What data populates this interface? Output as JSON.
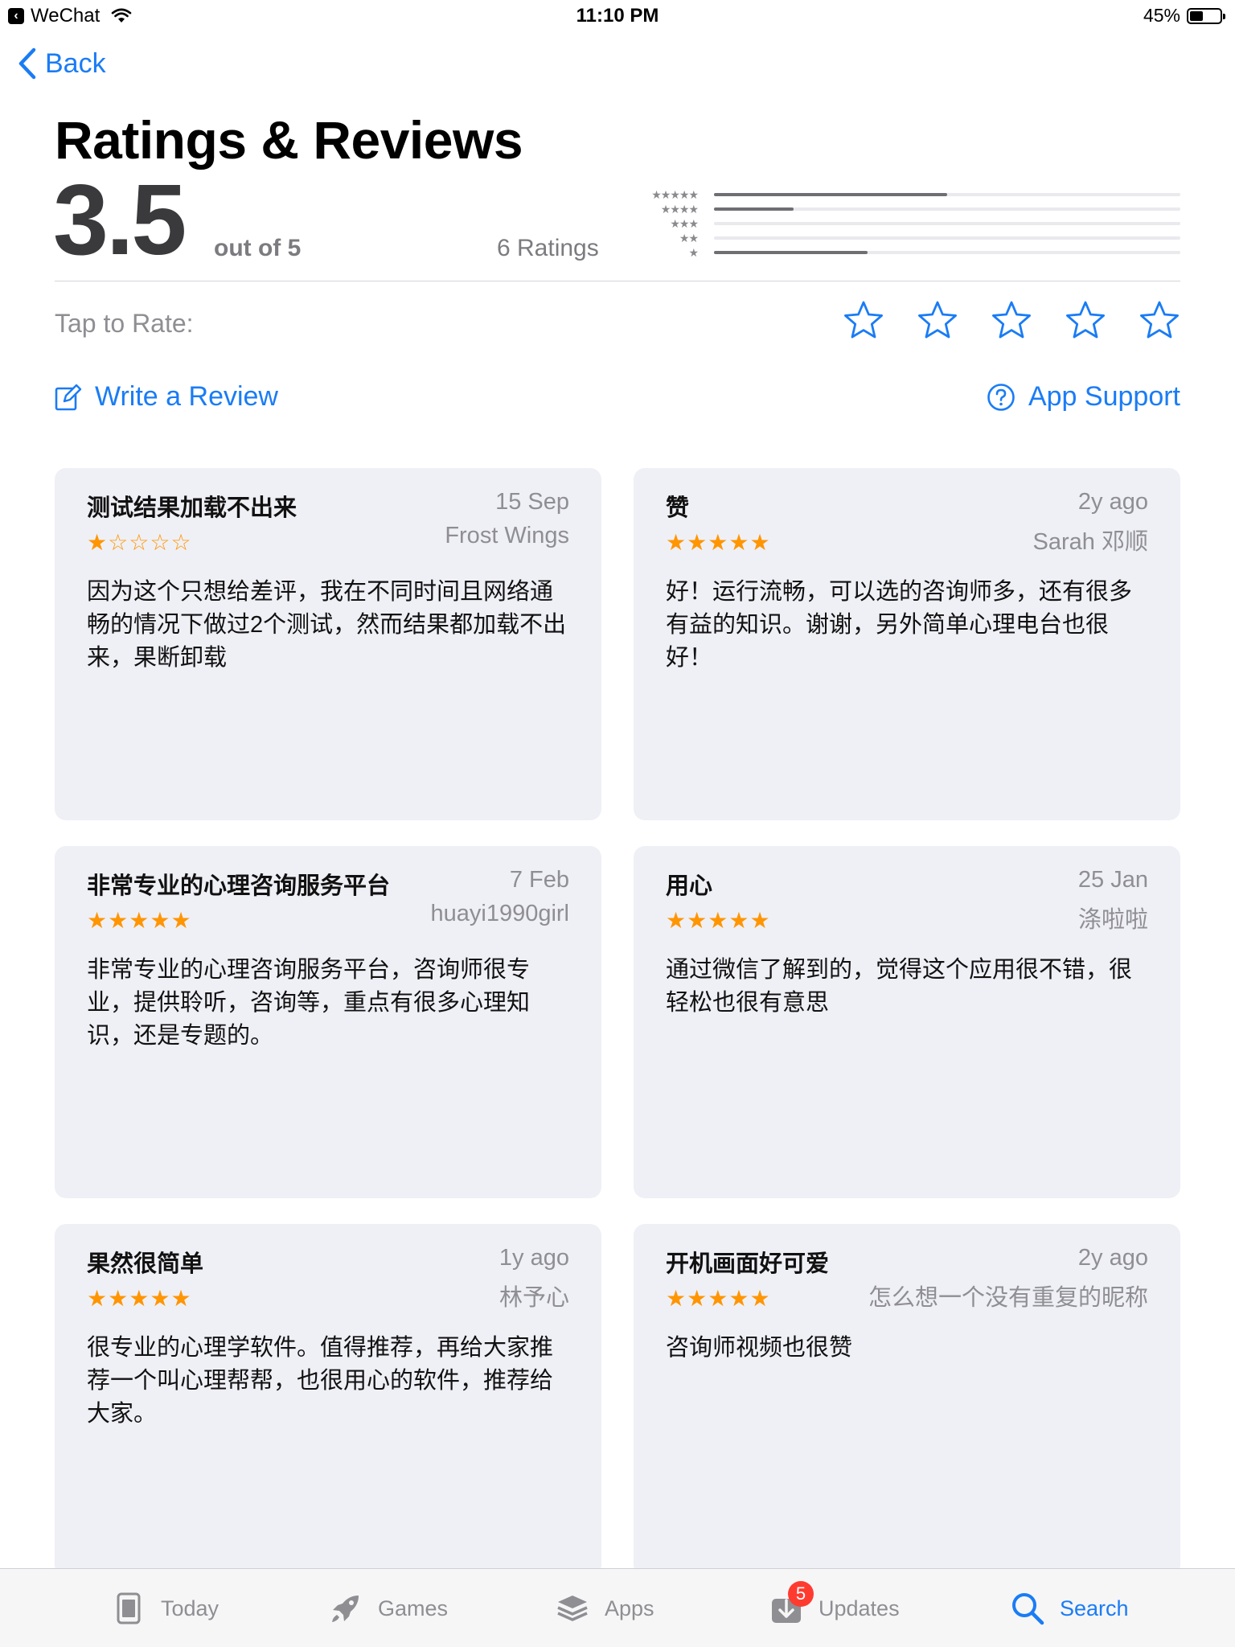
{
  "status_bar": {
    "app": "WeChat",
    "time": "11:10 PM",
    "battery": "45%",
    "battery_level": 0.45
  },
  "nav": {
    "back_label": "Back"
  },
  "page_title": "Ratings & Reviews",
  "summary": {
    "score": "3.5",
    "out_of": "out of 5",
    "ratings_count": "6 Ratings",
    "distribution": [
      {
        "stars": "★★★★★",
        "fraction": 0.5
      },
      {
        "stars": "★★★★",
        "fraction": 0.17
      },
      {
        "stars": "★★★",
        "fraction": 0
      },
      {
        "stars": "★★",
        "fraction": 0
      },
      {
        "stars": "★",
        "fraction": 0.33
      }
    ]
  },
  "tap_to_rate": {
    "label": "Tap to Rate:"
  },
  "actions": {
    "write_review": "Write a Review",
    "app_support": "App Support"
  },
  "reviews": [
    {
      "title": "测试结果加载不出来",
      "date": "15 Sep",
      "author": "Frost Wings",
      "rating": 1,
      "body": "因为这个只想给差评，我在不同时间且网络通畅的情况下做过2个测试，然而结果都加载不出来，果断卸载"
    },
    {
      "title": "赞",
      "date": "2y ago",
      "author": "Sarah 邓顺",
      "rating": 5,
      "body": "好！运行流畅，可以选的咨询师多，还有很多有益的知识。谢谢，另外简单心理电台也很好！"
    },
    {
      "title": "非常专业的心理咨询服务平台",
      "date": "7 Feb",
      "author": "huayi1990girl",
      "rating": 5,
      "body": "非常专业的心理咨询服务平台，咨询师很专业，提供聆听，咨询等，重点有很多心理知识，还是专题的。"
    },
    {
      "title": "用心",
      "date": "25 Jan",
      "author": "涤啦啦",
      "rating": 5,
      "body": "通过微信了解到的，觉得这个应用很不错，很轻松也很有意思"
    },
    {
      "title": "果然很简单",
      "date": "1y ago",
      "author": "林予心",
      "rating": 5,
      "body": "很专业的心理学软件。值得推荐，再给大家推荐一个叫心理帮帮，也很用心的软件，推荐给大家。"
    },
    {
      "title": "开机画面好可爱",
      "date": "2y ago",
      "author": "怎么想一个没有重复的昵称",
      "rating": 5,
      "body": "咨询师视频也很赞"
    }
  ],
  "tabbar": {
    "today": "Today",
    "games": "Games",
    "apps": "Apps",
    "updates": "Updates",
    "updates_badge": "5",
    "search": "Search"
  },
  "colors": {
    "accent": "#1a7cf5",
    "star": "#ff9500",
    "card_bg": "#eff0f6"
  }
}
